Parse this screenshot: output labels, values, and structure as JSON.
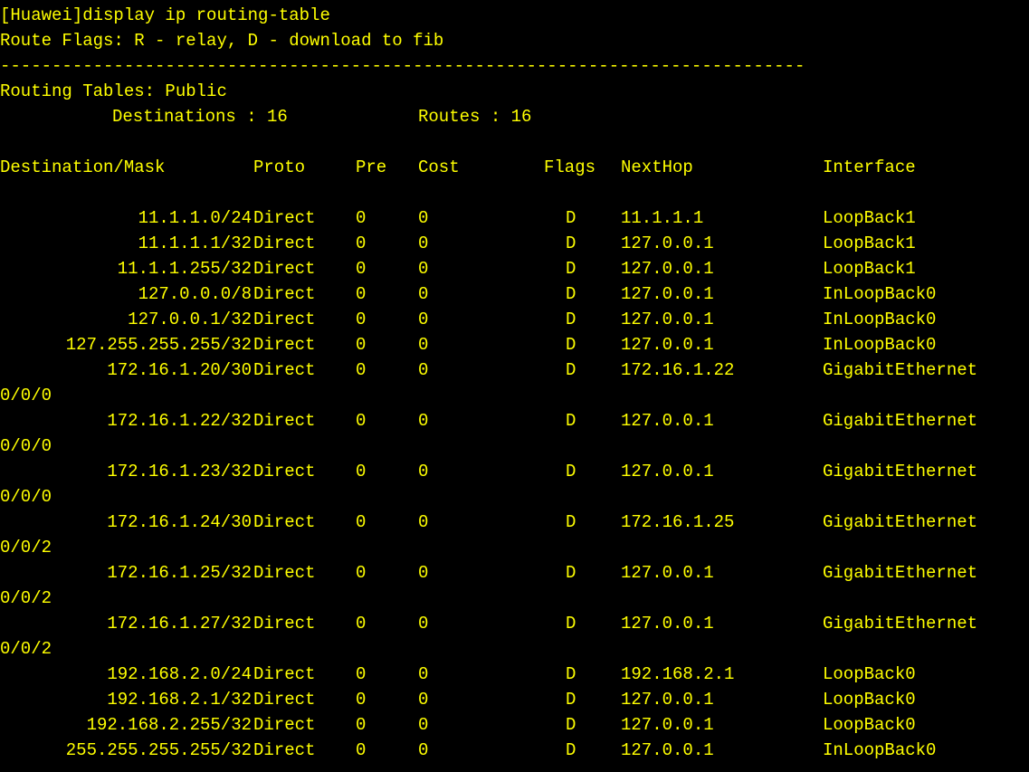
{
  "terminal": {
    "fg_color": "#ffff00",
    "bg_color": "#000000",
    "command": "[Huawei]display ip routing-table",
    "flags_legend": "Route Flags: R - relay, D - download to fib",
    "separator": "------------------------------------------------------------------------------",
    "table_title": "Routing Tables: Public",
    "destinations_label": "Destinations : 16",
    "routes_label": "Routes : 16",
    "headers": {
      "destination": "Destination/Mask",
      "proto": "Proto",
      "pre": "Pre",
      "cost": "Cost",
      "flags": "Flags",
      "nexthop": "NextHop",
      "interface": "Interface"
    },
    "routes": [
      {
        "dest": "11.1.1.0/24",
        "proto": "Direct",
        "pre": "0",
        "cost": "0",
        "flags": "D",
        "nexthop": "11.1.1.1",
        "iface": "LoopBack1",
        "wrap": ""
      },
      {
        "dest": "11.1.1.1/32",
        "proto": "Direct",
        "pre": "0",
        "cost": "0",
        "flags": "D",
        "nexthop": "127.0.0.1",
        "iface": "LoopBack1",
        "wrap": ""
      },
      {
        "dest": "11.1.1.255/32",
        "proto": "Direct",
        "pre": "0",
        "cost": "0",
        "flags": "D",
        "nexthop": "127.0.0.1",
        "iface": "LoopBack1",
        "wrap": ""
      },
      {
        "dest": "127.0.0.0/8",
        "proto": "Direct",
        "pre": "0",
        "cost": "0",
        "flags": "D",
        "nexthop": "127.0.0.1",
        "iface": "InLoopBack0",
        "wrap": ""
      },
      {
        "dest": "127.0.0.1/32",
        "proto": "Direct",
        "pre": "0",
        "cost": "0",
        "flags": "D",
        "nexthop": "127.0.0.1",
        "iface": "InLoopBack0",
        "wrap": ""
      },
      {
        "dest": "127.255.255.255/32",
        "proto": "Direct",
        "pre": "0",
        "cost": "0",
        "flags": "D",
        "nexthop": "127.0.0.1",
        "iface": "InLoopBack0",
        "wrap": ""
      },
      {
        "dest": "172.16.1.20/30",
        "proto": "Direct",
        "pre": "0",
        "cost": "0",
        "flags": "D",
        "nexthop": "172.16.1.22",
        "iface": "GigabitEthernet",
        "wrap": "0/0/0"
      },
      {
        "dest": "172.16.1.22/32",
        "proto": "Direct",
        "pre": "0",
        "cost": "0",
        "flags": "D",
        "nexthop": "127.0.0.1",
        "iface": "GigabitEthernet",
        "wrap": "0/0/0"
      },
      {
        "dest": "172.16.1.23/32",
        "proto": "Direct",
        "pre": "0",
        "cost": "0",
        "flags": "D",
        "nexthop": "127.0.0.1",
        "iface": "GigabitEthernet",
        "wrap": "0/0/0"
      },
      {
        "dest": "172.16.1.24/30",
        "proto": "Direct",
        "pre": "0",
        "cost": "0",
        "flags": "D",
        "nexthop": "172.16.1.25",
        "iface": "GigabitEthernet",
        "wrap": "0/0/2"
      },
      {
        "dest": "172.16.1.25/32",
        "proto": "Direct",
        "pre": "0",
        "cost": "0",
        "flags": "D",
        "nexthop": "127.0.0.1",
        "iface": "GigabitEthernet",
        "wrap": "0/0/2"
      },
      {
        "dest": "172.16.1.27/32",
        "proto": "Direct",
        "pre": "0",
        "cost": "0",
        "flags": "D",
        "nexthop": "127.0.0.1",
        "iface": "GigabitEthernet",
        "wrap": "0/0/2"
      },
      {
        "dest": "192.168.2.0/24",
        "proto": "Direct",
        "pre": "0",
        "cost": "0",
        "flags": "D",
        "nexthop": "192.168.2.1",
        "iface": "LoopBack0",
        "wrap": ""
      },
      {
        "dest": "192.168.2.1/32",
        "proto": "Direct",
        "pre": "0",
        "cost": "0",
        "flags": "D",
        "nexthop": "127.0.0.1",
        "iface": "LoopBack0",
        "wrap": ""
      },
      {
        "dest": "192.168.2.255/32",
        "proto": "Direct",
        "pre": "0",
        "cost": "0",
        "flags": "D",
        "nexthop": "127.0.0.1",
        "iface": "LoopBack0",
        "wrap": ""
      },
      {
        "dest": "255.255.255.255/32",
        "proto": "Direct",
        "pre": "0",
        "cost": "0",
        "flags": "D",
        "nexthop": "127.0.0.1",
        "iface": "InLoopBack0",
        "wrap": ""
      }
    ]
  }
}
